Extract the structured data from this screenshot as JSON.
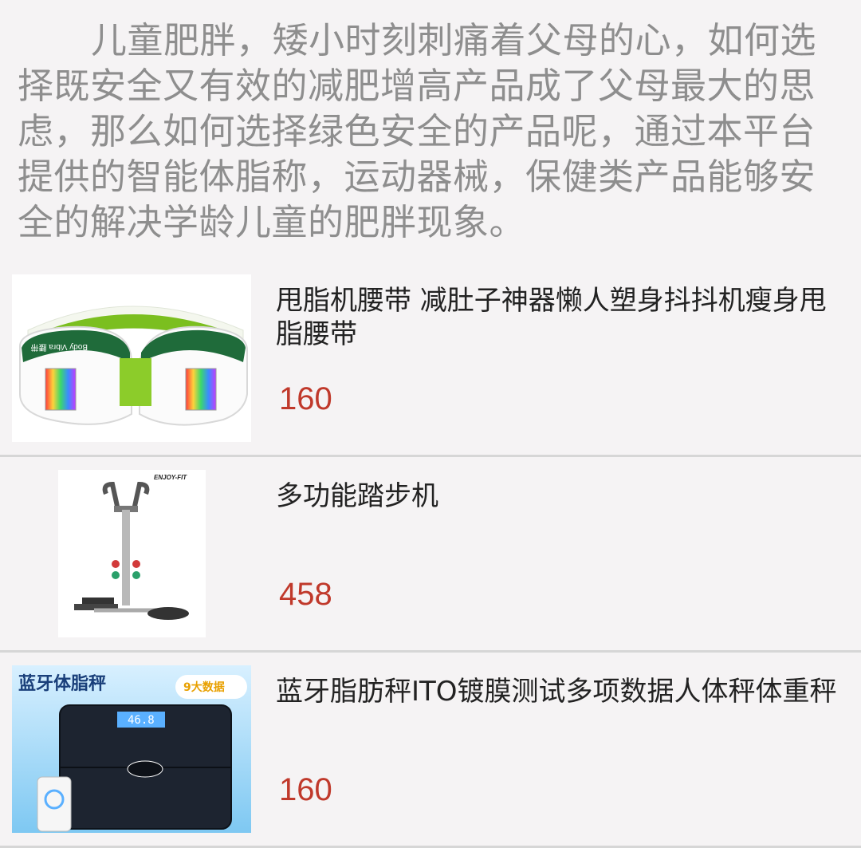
{
  "intro": "儿童肥胖，矮小时刻刺痛着父母的心，如何选择既安全又有效的减肥增高产品成了父母最大的思虑，那么如何选择绿色安全的产品呢，通过本平台提供的智能体脂称，运动器械，保健类产品能够安全的解决学龄儿童的肥胖现象。",
  "products": [
    {
      "title": "甩脂机腰带 减肚子神器懒人塑身抖抖机瘦身甩脂腰带",
      "price": "160",
      "image_label": "Body Vibra 腰带"
    },
    {
      "title": "多功能踏步机",
      "price": "458",
      "image_label": "ENJOY-FIT"
    },
    {
      "title": "蓝牙脂肪秤ITO镀膜测试多项数据人体秤体重秤",
      "price": "160",
      "image_label": "蓝牙体脂秤",
      "image_badge": "9大数据",
      "image_reading": "46.8"
    }
  ]
}
